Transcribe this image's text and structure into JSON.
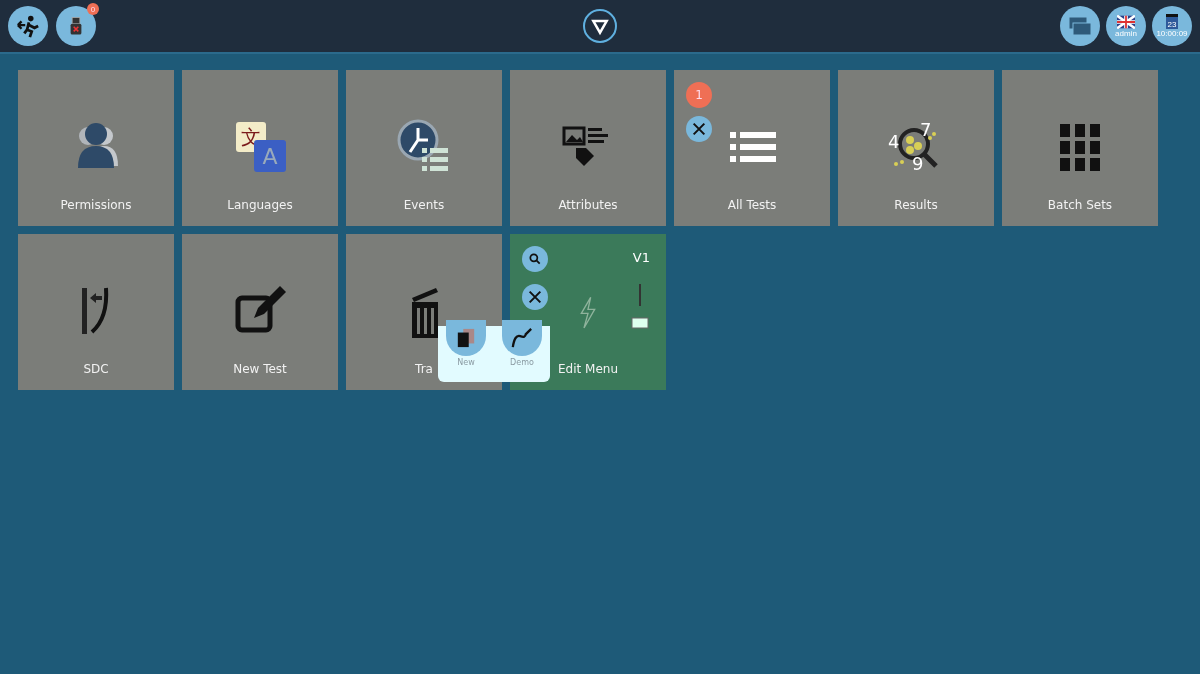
{
  "header": {
    "usb_badge": "0",
    "user": "admin",
    "calendar_day": "23",
    "clock": "10:00:09"
  },
  "tiles": [
    {
      "label": "Permissions",
      "selected": false
    },
    {
      "label": "Languages",
      "selected": false,
      "glyphs": [
        "文",
        "A"
      ]
    },
    {
      "label": "Events",
      "selected": false
    },
    {
      "label": "Attributes",
      "selected": false
    },
    {
      "label": "All Tests",
      "selected": false,
      "badge": "1"
    },
    {
      "label": "Results",
      "selected": false,
      "glyphs": [
        "4",
        "7",
        "9"
      ]
    },
    {
      "label": "Batch Sets",
      "selected": false
    },
    {
      "label": "SDC",
      "selected": false
    },
    {
      "label": "New Test",
      "selected": false
    },
    {
      "label": "Tra",
      "selected": false
    },
    {
      "label": "Edit Menu",
      "selected": true,
      "version": "V1"
    }
  ],
  "popup": {
    "items": [
      "New",
      "Demo"
    ]
  }
}
